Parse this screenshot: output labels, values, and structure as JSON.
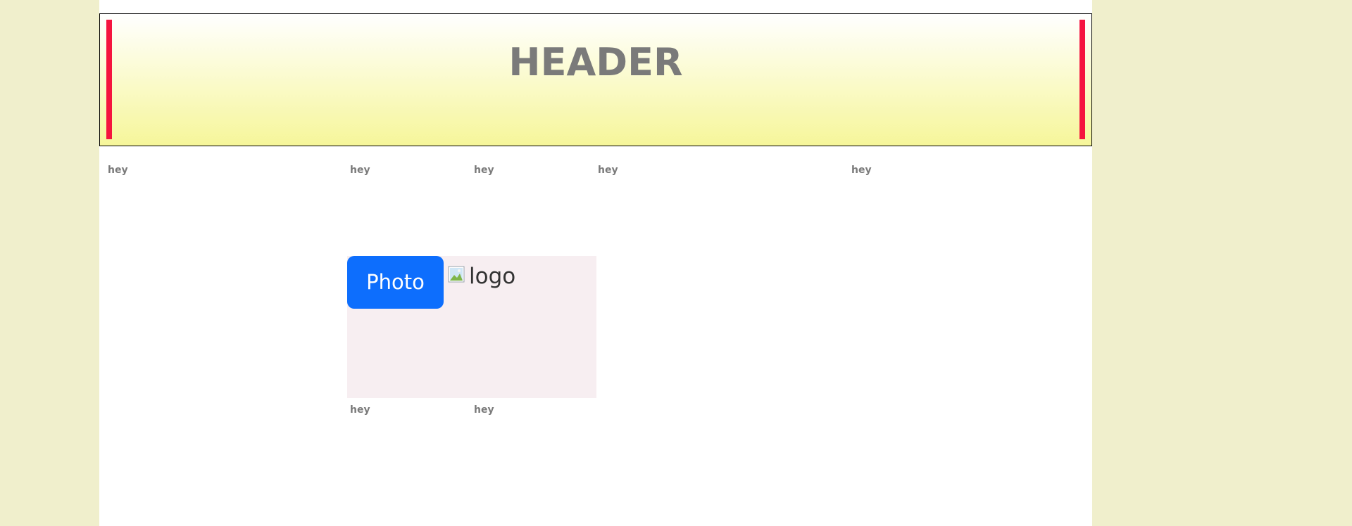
{
  "header": {
    "title": "HEADER",
    "accent_color": "#f5143e",
    "gradient_top": "#ffffff",
    "gradient_bottom": "#f6f69a"
  },
  "row1": {
    "labels": [
      "hey",
      "hey",
      "hey",
      "hey",
      "hey"
    ]
  },
  "panel": {
    "photo_button_label": "Photo",
    "logo_alt": "logo",
    "logo_icon": "broken-image-icon",
    "button_color": "#0d6efd",
    "background": "#f7eef1"
  },
  "row2": {
    "labels": [
      "hey",
      "hey"
    ]
  },
  "page": {
    "background": "#f0efcc"
  }
}
